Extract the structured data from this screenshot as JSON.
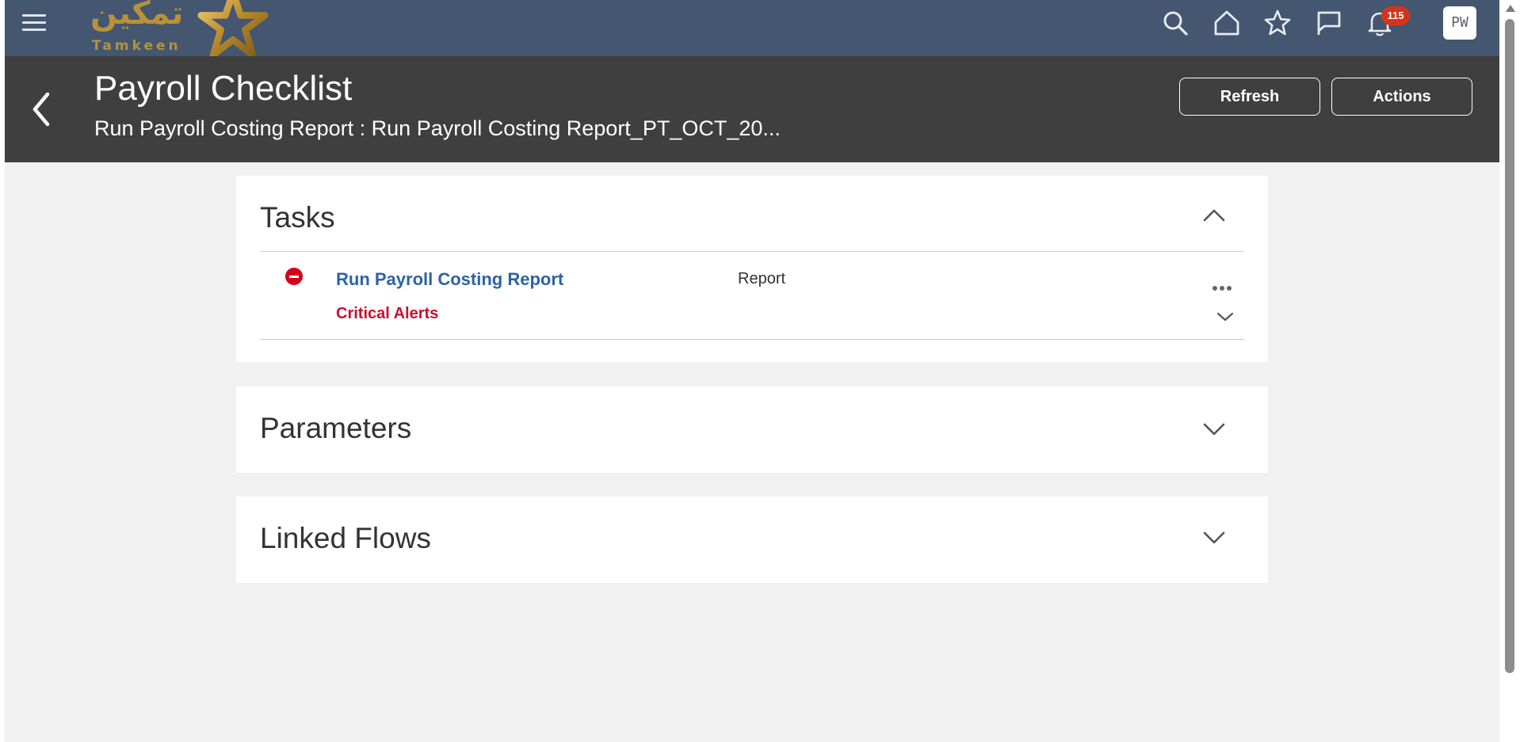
{
  "brand": {
    "arabic": "تمكين",
    "latin": "Tamkeen",
    "colors": {
      "gold": "#b7923a",
      "nav_bg": "#445670",
      "header_bg": "#3f3f3f",
      "link": "#2e62a3",
      "alert": "#c8102e"
    }
  },
  "topbar": {
    "menu_icon": "hamburger-icon",
    "icons": [
      "search-icon",
      "home-icon",
      "star-icon",
      "flag-icon",
      "bell-icon"
    ],
    "notification_count": "115",
    "user_initials": "PW"
  },
  "header": {
    "title": "Payroll Checklist",
    "subtitle": "Run Payroll Costing Report : Run Payroll Costing Report_PT_OCT_20...",
    "refresh_label": "Refresh",
    "actions_label": "Actions"
  },
  "tasks": {
    "title": "Tasks",
    "items": [
      {
        "name": "Run Payroll Costing Report",
        "type": "Report",
        "status": "Critical Alerts",
        "status_icon": "error-icon"
      }
    ]
  },
  "parameters": {
    "title": "Parameters"
  },
  "linked_flows": {
    "title": "Linked Flows"
  }
}
